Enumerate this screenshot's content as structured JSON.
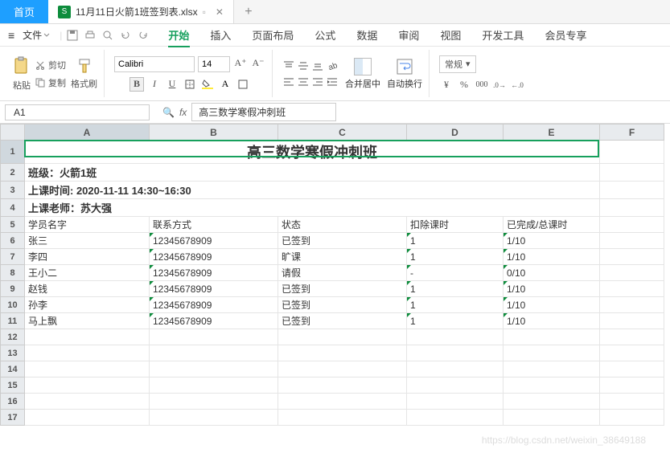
{
  "tabs": {
    "home": "首页",
    "file": "11月11日火箭1班签到表.xlsx"
  },
  "menu": {
    "file": "文件",
    "items": [
      "开始",
      "插入",
      "页面布局",
      "公式",
      "数据",
      "审阅",
      "视图",
      "开发工具",
      "会员专享"
    ],
    "active": "开始"
  },
  "ribbon": {
    "paste": "粘贴",
    "cut": "剪切",
    "copy": "复制",
    "format_painter": "格式刷",
    "font": "Calibri",
    "size": "14",
    "merge": "合并居中",
    "wrap": "自动换行",
    "number_format": "常规"
  },
  "namebox": {
    "cell": "A1",
    "fx": "高三数学寒假冲刺班"
  },
  "columns": [
    "A",
    "B",
    "C",
    "D",
    "E",
    "F"
  ],
  "sheet": {
    "title": "高三数学寒假冲刺班",
    "class": "班级：火箭1班",
    "time": "上课时间: 2020-11-11 14:30~16:30",
    "teacher": "上课老师：苏大强",
    "headers": [
      "学员名字",
      "联系方式",
      "状态",
      "扣除课时",
      "已完成/总课时"
    ],
    "rows": [
      {
        "name": "张三",
        "phone": "12345678909",
        "status": "已签到",
        "deduct": "1",
        "progress": "1/10"
      },
      {
        "name": "李四",
        "phone": "12345678909",
        "status": "旷课",
        "deduct": "1",
        "progress": "1/10"
      },
      {
        "name": "王小二",
        "phone": "12345678909",
        "status": "请假",
        "deduct": "-",
        "progress": "0/10"
      },
      {
        "name": "赵钱",
        "phone": "12345678909",
        "status": "已签到",
        "deduct": "1",
        "progress": "1/10"
      },
      {
        "name": "孙李",
        "phone": "12345678909",
        "status": "已签到",
        "deduct": "1",
        "progress": "1/10"
      },
      {
        "name": "马上飘",
        "phone": "12345678909",
        "status": "已签到",
        "deduct": "1",
        "progress": "1/10"
      }
    ]
  },
  "watermark": "https://blog.csdn.net/weixin_38649188"
}
